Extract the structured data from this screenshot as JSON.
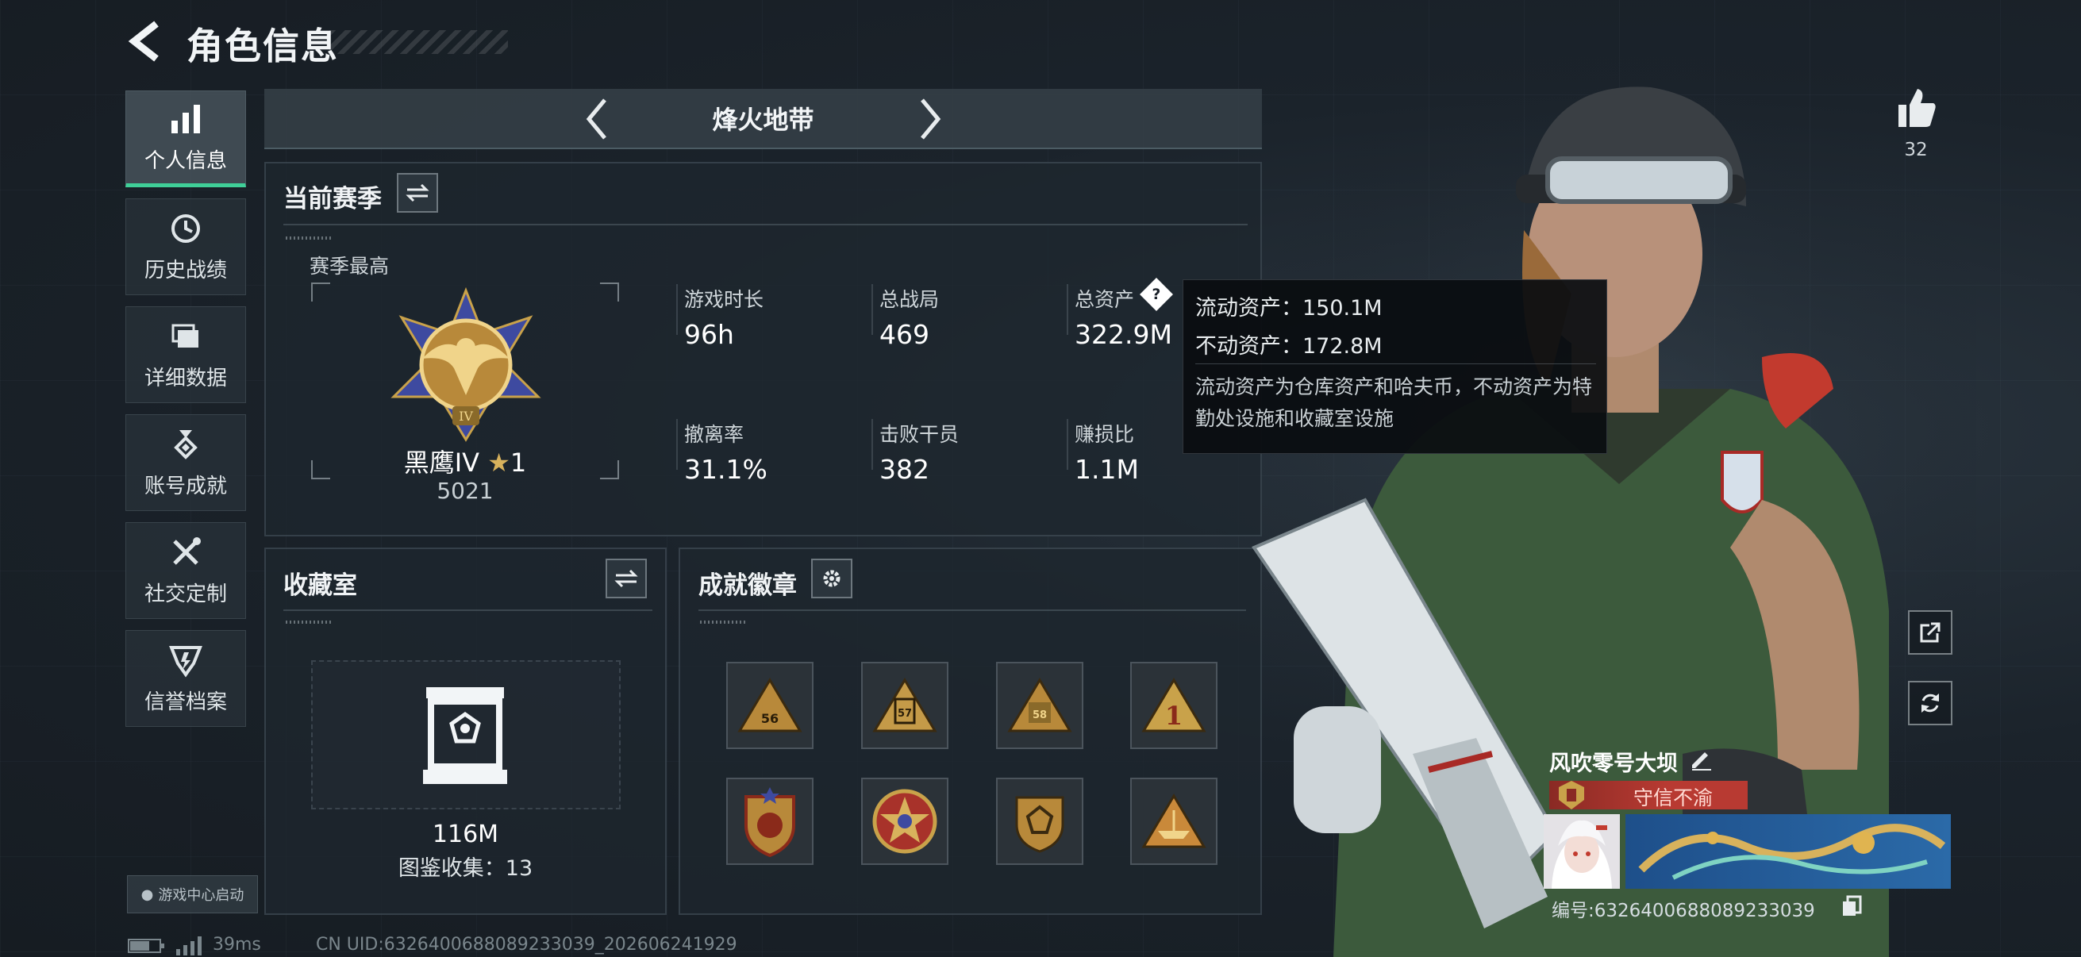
{
  "header": {
    "title": "角色信息"
  },
  "sidebar": {
    "items": [
      {
        "label": "个人信息",
        "icon": "bar-chart-icon",
        "active": true
      },
      {
        "label": "历史战绩",
        "icon": "history-clock-icon"
      },
      {
        "label": "详细数据",
        "icon": "folder-icon"
      },
      {
        "label": "账号成就",
        "icon": "medal-icon"
      },
      {
        "label": "社交定制",
        "icon": "tools-icon"
      },
      {
        "label": "信誉档案",
        "icon": "credit-icon"
      }
    ],
    "launch_label": "游戏中心启动"
  },
  "mode": {
    "label": "烽火地带"
  },
  "season": {
    "title": "当前赛季",
    "best_label": "赛季最高",
    "rank_name": "黑鹰IV",
    "rank_stars": "1",
    "rank_score": "5021",
    "stats": [
      {
        "label": "游戏时长",
        "value": "96h"
      },
      {
        "label": "总战局",
        "value": "469"
      },
      {
        "label": "总资产",
        "value": "322.9M"
      },
      {
        "label": "撤离率",
        "value": "31.1%"
      },
      {
        "label": "击败干员",
        "value": "382"
      },
      {
        "label": "赚损比",
        "value": "1.1M"
      }
    ]
  },
  "tooltip": {
    "liquid": "流动资产：150.1M",
    "fixed": "不动资产：172.8M",
    "note": "流动资产为仓库资产和哈夫币，不动资产为特勤处设施和收藏室设施"
  },
  "collection": {
    "title": "收藏室",
    "value": "116M",
    "count_label": "图鉴收集：13"
  },
  "achievements": {
    "title": "成就徽章",
    "badges": [
      "56",
      "57",
      "58",
      "1",
      "shield-star",
      "round-star",
      "gem-shield",
      "boat"
    ]
  },
  "profile": {
    "likes": "32",
    "name": "风吹零号大坝",
    "honor": "守信不渝",
    "uid_label": "编号:6326400688089233039"
  },
  "footer": {
    "ping": "39ms",
    "uid": "CN UID:6326400688089233039_202606241929"
  },
  "colors": {
    "accent": "#3fcf98",
    "honor_red": "#b83a32",
    "gold": "#c9a24a"
  }
}
